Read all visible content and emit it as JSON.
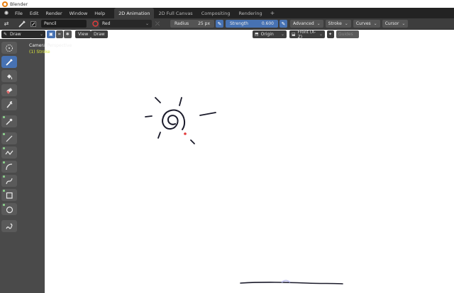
{
  "window": {
    "title": "Blender"
  },
  "menu": {
    "items": [
      "File",
      "Edit",
      "Render",
      "Window",
      "Help"
    ]
  },
  "workspaces": {
    "tabs": [
      "2D Animation",
      "2D Full Canvas",
      "Compositing",
      "Rendering"
    ],
    "active": "2D Animation",
    "add_label": "+"
  },
  "tool_settings": {
    "brush_name": "Pencil",
    "material": "Red",
    "radius_label": "Radius",
    "radius_value": "25 px",
    "strength_label": "Strength",
    "strength_value": "0.600",
    "menus": [
      "Advanced",
      "Stroke",
      "Curves",
      "Cursor"
    ]
  },
  "viewport_header": {
    "mode": "Draw",
    "view_menu": "View",
    "draw_menu": "Draw",
    "origin": "Origin",
    "view_axis": "Front (X-Z)",
    "disabled_field": "Guides"
  },
  "viewport_info": {
    "camera": "Camera Perspective",
    "object": "(1) Stroke"
  },
  "toolbar": {
    "tools": [
      "select-circle",
      "draw",
      "fill",
      "erase",
      "tint",
      "eyedropper",
      "line",
      "polyline",
      "arc",
      "curve",
      "box",
      "circle",
      "annotate"
    ],
    "active": "draw"
  },
  "colors": {
    "header_bg": "#3d3d3d",
    "menubar_bg": "#232323",
    "toolbar_bg": "#4a4a4a",
    "accent_blue": "#4772b3",
    "stroke": "#1a1a2a",
    "cursor_dot": "#e33b3b"
  }
}
